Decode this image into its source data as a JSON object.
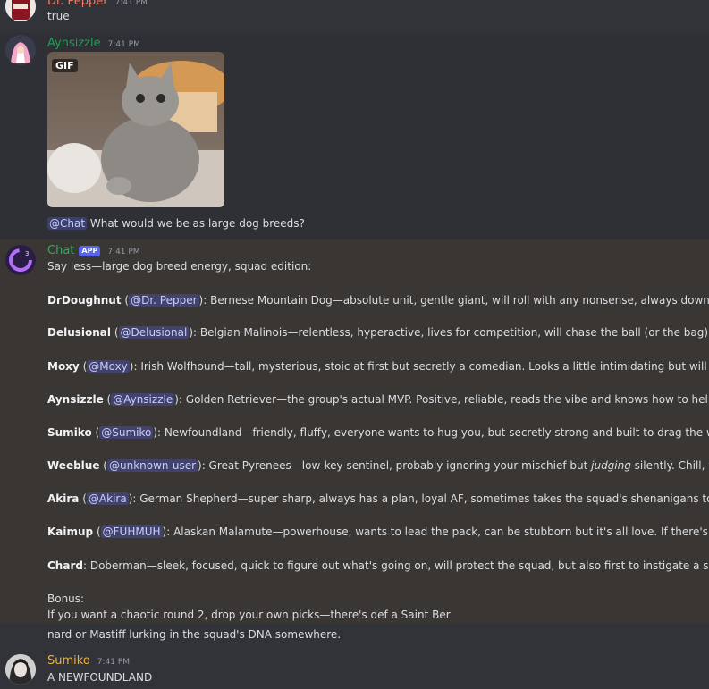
{
  "messages": {
    "drpepper": {
      "username": "Dr. Pepper",
      "timestamp": "7:41 PM",
      "text": "true",
      "name_color": "#f47b67"
    },
    "aynsizzle": {
      "username": "Aynsizzle",
      "timestamp": "7:41 PM",
      "name_color": "#1f9d55",
      "gif_label": "GIF",
      "mention": "@Chat",
      "question": " What would we be as large dog breeds?"
    },
    "chat": {
      "username": "Chat",
      "badge": "APP",
      "timestamp": "7:41 PM",
      "name_color": "#3ba55d",
      "intro": "Say less—large dog breed energy, squad edition:",
      "entries": [
        {
          "name": "DrDoughnut",
          "mention": "@Dr. Pepper",
          "text": ": Bernese Mountain Dog—absolute unit, gentle giant, will roll with any nonsense, always down to chill, h"
        },
        {
          "name": "Delusional",
          "mention": "@Delusional",
          "text": ": Belgian Malinois—relentless, hyperactive, lives for competition, will chase the ball (or the bag) till the s"
        },
        {
          "name": "Moxy",
          "mention": "@Moxy",
          "text": ": Irish Wolfhound—tall, mysterious, stoic at first but secretly a comedian. Looks a little intimidating but will instant"
        },
        {
          "name": "Aynsizzle",
          "mention": "@Aynsizzle",
          "text": ": Golden Retriever—the group's actual MVP. Positive, reliable, reads the vibe and knows how to help anyone"
        },
        {
          "name": "Sumiko",
          "mention": "@Sumiko",
          "text": ": Newfoundland—friendly, fluffy, everyone wants to hug you, but secretly strong and built to drag the whole squ"
        },
        {
          "name": "Weeblue",
          "mention": "@unknown-user",
          "text": ": Great Pyrenees—low-key sentinel, probably ignoring your mischief but ",
          "italic": "judging",
          "text_after": " silently. Chill, wise, bu"
        },
        {
          "name": "Akira",
          "mention": "@Akira",
          "text": ": German Shepherd—super sharp, always has a plan, loyal AF, sometimes takes the squad's shenanigans too seriou"
        },
        {
          "name": "Kaimup",
          "mention": "@FUHMUH",
          "text": ": Alaskan Malamute—powerhouse, wants to lead the pack, can be stubborn but it's all love. If there's a snow"
        },
        {
          "name": "Chard",
          "text": ": Doberman—sleek, focused, quick to figure out what's going on, will protect the squad, but also first to instigate a side ques"
        }
      ],
      "bonus_title": "Bonus:",
      "bonus_line1": "If you want a chaotic round 2, drop your own picks—there's def a Saint Ber",
      "bonus_line2": "nard or Mastiff lurking in the squad's DNA somewhere."
    },
    "sumiko": {
      "username": "Sumiko",
      "timestamp": "7:41 PM",
      "name_color": "#f0b232",
      "text": "A NEWFOUNDLAND"
    }
  }
}
